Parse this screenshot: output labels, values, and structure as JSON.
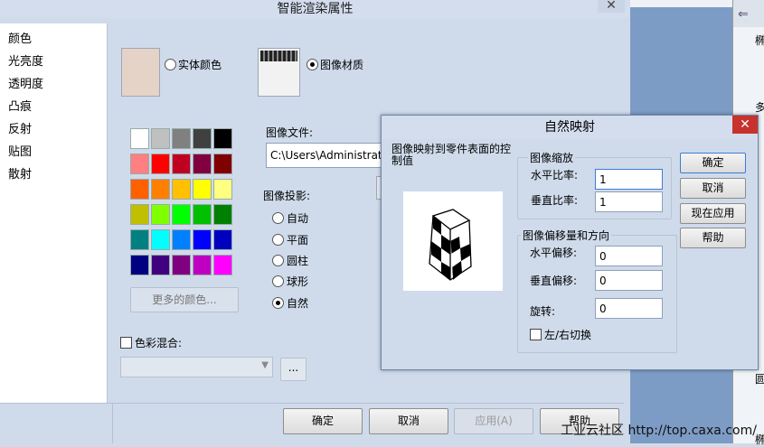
{
  "main_window": {
    "title": "智能渲染属性",
    "close_glyph": "✕",
    "properties": [
      "颜色",
      "光亮度",
      "透明度",
      "凸痕",
      "反射",
      "贴图",
      "散射"
    ],
    "solid_color_label": "实体颜色",
    "image_material_label": "图像材质",
    "more_colors_label": "更多的颜色...",
    "color_mix_label": "色彩混合:",
    "ellipsis_label": "...",
    "image_file_label": "图像文件:",
    "image_file_value": "C:\\Users\\Administrato",
    "projection_label": "图像投影:",
    "projections": [
      "自动",
      "平面",
      "圆柱",
      "球形",
      "自然"
    ],
    "selected_projection": "自然",
    "palette": [
      [
        "#ffffff",
        "#c0c0c0",
        "#808080",
        "#404040",
        "#000000"
      ],
      [
        "#ff8080",
        "#ff0000",
        "#c00020",
        "#800040",
        "#800000"
      ],
      [
        "#ff6000",
        "#ff8000",
        "#ffc000",
        "#ffff00",
        "#ffff80"
      ],
      [
        "#c0c000",
        "#80ff00",
        "#00ff00",
        "#00c000",
        "#008000"
      ],
      [
        "#008080",
        "#00ffff",
        "#0080ff",
        "#0000ff",
        "#0000c0"
      ],
      [
        "#000080",
        "#400080",
        "#800080",
        "#c000c0",
        "#ff00ff"
      ]
    ],
    "solid_color_swatch": "#e6d3c7",
    "buttons": {
      "ok": "确定",
      "cancel": "取消",
      "apply": "应用(A)",
      "help": "帮助"
    }
  },
  "dialog": {
    "title": "自然映射",
    "close_glyph": "✕",
    "description": "图像映射到零件表面的控制值",
    "scale_group": "图像缩放",
    "horizontal_ratio_label": "水平比率:",
    "horizontal_ratio_value": "1",
    "vertical_ratio_label": "垂直比率:",
    "vertical_ratio_value": "1",
    "offset_group": "图像偏移量和方向",
    "horizontal_offset_label": "水平偏移:",
    "horizontal_offset_value": "0",
    "vertical_offset_label": "垂直偏移:",
    "vertical_offset_value": "0",
    "rotation_label": "旋转:",
    "rotation_value": "0",
    "flip_label": "左/右切换",
    "buttons": {
      "ok": "确定",
      "cancel": "取消",
      "apply_now": "现在应用",
      "help": "帮助"
    }
  },
  "background": {
    "right_labels": [
      "椭",
      "多",
      "圆",
      "椭"
    ]
  },
  "watermark": "工业云社区 http://top.caxa.com/"
}
